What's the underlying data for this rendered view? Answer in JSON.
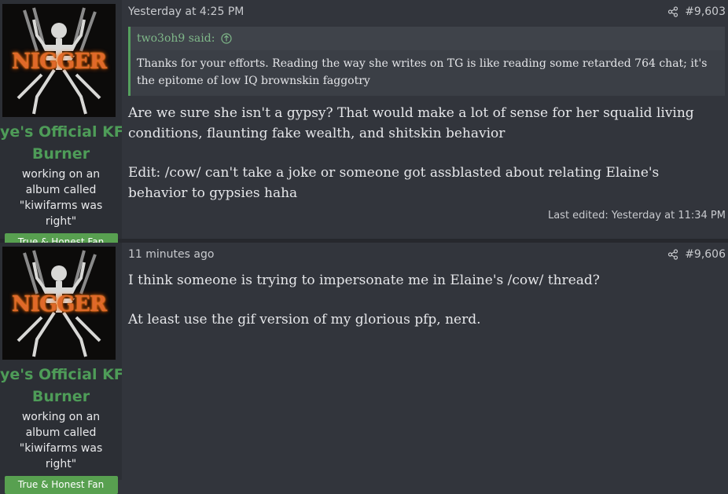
{
  "posts": [
    {
      "user": {
        "avatar_text": "NIGGER",
        "name_line1": "ye's Official KF",
        "name_line2": "Burner",
        "title": "working on an album called \"kiwifarms was right\"",
        "banner": "True & Honest Fan"
      },
      "date": "Yesterday at 4:25 PM",
      "number": "#9,603",
      "quote": {
        "author": "two3oh9 said:",
        "text": "Thanks for your efforts. Reading the way she writes on TG is like reading some retarded 764 chat; it's the epitome of low IQ brownskin faggotry"
      },
      "paragraphs": [
        "Are we sure she isn't a gypsy? That would make a lot of sense for her squalid living conditions, flaunting fake wealth, and shitskin behavior",
        "Edit: /cow/ can't take a joke or someone got assblasted about relating Elaine's behavior to gypsies haha"
      ],
      "edited": "Last edited: Yesterday at 11:34 PM"
    },
    {
      "user": {
        "avatar_text": "NIGGER",
        "name_line1": "ye's Official KF",
        "name_line2": "Burner",
        "title": "working on an album called \"kiwifarms was right\"",
        "banner": "True & Honest Fan"
      },
      "date": "11 minutes ago",
      "number": "#9,606",
      "paragraphs": [
        "I think someone is trying to impersonate me in Elaine's /cow/ thread?",
        "At least use the gif version of my glorious pfp, nerd."
      ]
    }
  ],
  "icons": {
    "share": "share-icon",
    "quote_jump": "arrow-up-circle-icon"
  },
  "colors": {
    "username": "#4e9c58",
    "banner": "#58a050",
    "quote_border": "#55a05e"
  }
}
